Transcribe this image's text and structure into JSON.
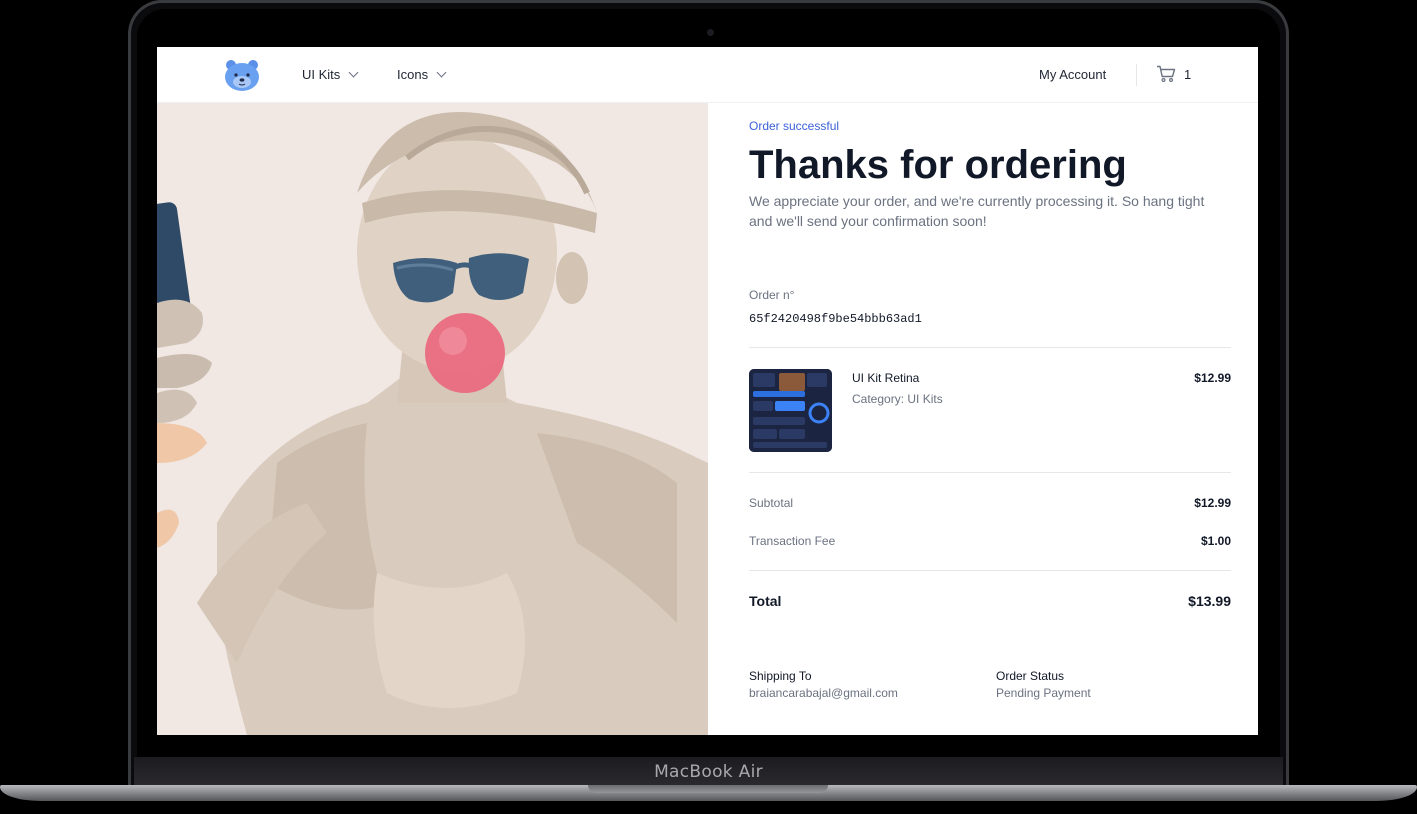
{
  "device": {
    "label": "MacBook Air"
  },
  "nav": {
    "items": [
      {
        "label": "UI Kits"
      },
      {
        "label": "Icons"
      }
    ],
    "account_label": "My Account",
    "cart_count": "1"
  },
  "order": {
    "eyebrow": "Order successful",
    "title": "Thanks for ordering",
    "lead": "We appreciate your order, and we're currently processing it. So hang tight and we'll send your confirmation soon!",
    "number_label": "Order n°",
    "number": "65f2420498f9be54bbb63ad1"
  },
  "product": {
    "name": "UI Kit Retina",
    "category": "Category: UI Kits",
    "price": "$12.99"
  },
  "summary": {
    "subtotal_label": "Subtotal",
    "subtotal": "$12.99",
    "fee_label": "Transaction Fee",
    "fee": "$1.00",
    "total_label": "Total",
    "total": "$13.99"
  },
  "shipping": {
    "title": "Shipping To",
    "email": "braiancarabajal@gmail.com"
  },
  "status": {
    "title": "Order Status",
    "value": "Pending Payment"
  },
  "colors": {
    "accent": "#3b62d6",
    "hero_bg": "#f1e7e3",
    "text_primary": "#111827",
    "text_muted": "#6b7280"
  },
  "icons": [
    "logo-bear-icon",
    "chevron-down-icon",
    "cart-icon"
  ]
}
